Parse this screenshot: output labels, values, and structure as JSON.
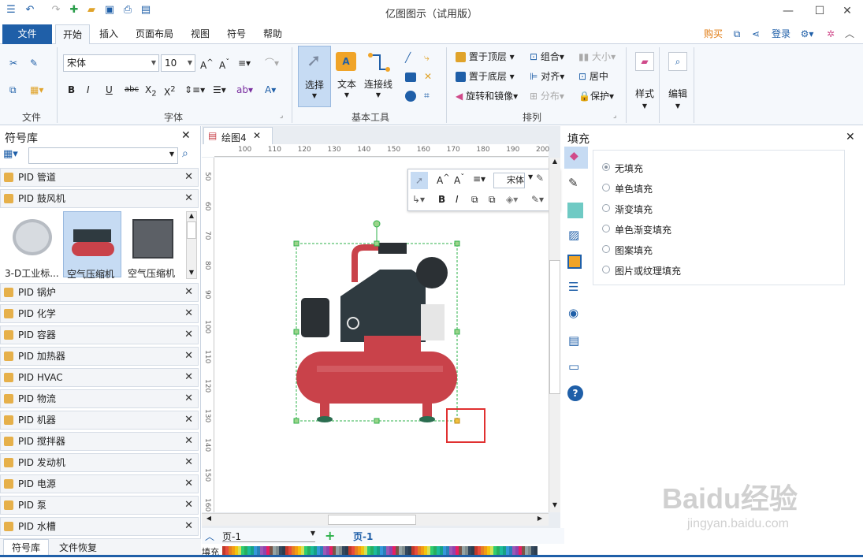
{
  "window": {
    "title": "亿图图示（试用版）"
  },
  "menu": {
    "file": "文件",
    "tabs": [
      "开始",
      "插入",
      "页面布局",
      "视图",
      "符号",
      "帮助"
    ],
    "buy": "购买",
    "login": "登录"
  },
  "ribbon": {
    "font_name": "宋体",
    "font_size": "10",
    "groups": {
      "file": "文件",
      "font": "字体",
      "basic_tools": "基本工具",
      "arrange": "排列"
    },
    "tools": {
      "select": "选择",
      "text": "文本",
      "connector": "连接线"
    },
    "arrange": {
      "bring_front": "置于顶层",
      "send_back": "置于底层",
      "rotate": "旋转和镜像",
      "group": "组合",
      "align": "对齐",
      "distribute": "分布",
      "size": "大小",
      "center": "居中",
      "protect": "保护"
    },
    "style": "样式",
    "edit": "编辑"
  },
  "library": {
    "title": "符号库",
    "search_placeholder": "",
    "open_libs": [
      "PID 管道",
      "PID 鼓风机"
    ],
    "shapes": [
      "3-D工业标...",
      "空气压缩机",
      "空气压缩机"
    ],
    "libs": [
      "PID 锅炉",
      "PID 化学",
      "PID 容器",
      "PID 加热器",
      "PID HVAC",
      "PID 物流",
      "PID 机器",
      "PID 搅拌器",
      "PID 发动机",
      "PID 电源",
      "PID 泵",
      "PID 水槽"
    ],
    "bottom_tabs": [
      "符号库",
      "文件恢复"
    ]
  },
  "document": {
    "tab": "绘图4",
    "page_select": "页-1",
    "page_tab": "页-1",
    "fill_label": "填充"
  },
  "ruler": {
    "top": [
      "100",
      "110",
      "120",
      "130",
      "140",
      "150",
      "160",
      "170",
      "180",
      "190",
      "200"
    ],
    "left": [
      "50",
      "60",
      "70",
      "80",
      "90",
      "100",
      "110",
      "120",
      "130",
      "140",
      "150",
      "160"
    ]
  },
  "float_toolbar": {
    "font": "宋体"
  },
  "fill_panel": {
    "title": "填充",
    "options": [
      "无填充",
      "单色填充",
      "渐变填充",
      "单色渐变填充",
      "图案填充",
      "图片或纹理填充"
    ],
    "selected": "无填充"
  },
  "watermark": {
    "brand": "Baidu经验",
    "url": "jingyan.baidu.com"
  },
  "colors": {
    "accent": "#1f5fa8",
    "highlight_box": "#e03030"
  }
}
